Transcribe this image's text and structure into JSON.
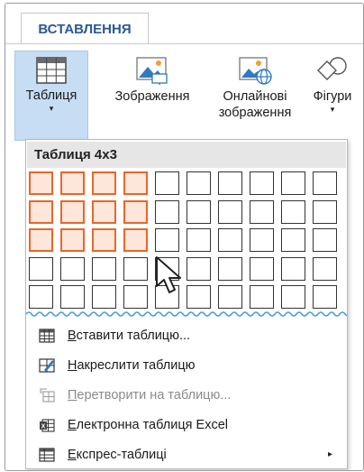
{
  "ribbon": {
    "tab_label": "ВСТАВЛЕННЯ",
    "buttons": [
      {
        "label": "Таблиця",
        "label2": "",
        "caret": "▾"
      },
      {
        "label": "Зображення",
        "label2": "",
        "caret": ""
      },
      {
        "label": "Онлайнові",
        "label2": "зображення",
        "caret": ""
      },
      {
        "label": "Фігури",
        "label2": "",
        "caret": "▾"
      }
    ]
  },
  "table_picker": {
    "header": "Таблиця 4x3",
    "columns": 10,
    "rows": 5,
    "selected_columns": 4,
    "selected_rows": 3
  },
  "menu": {
    "items": [
      {
        "accel": "В",
        "rest": "ставити таблицю...",
        "icon": "insert-table-icon",
        "enabled": true,
        "submenu": false
      },
      {
        "accel": "Н",
        "rest": "акреслити таблицю",
        "icon": "draw-table-icon",
        "enabled": true,
        "submenu": false
      },
      {
        "accel": "П",
        "rest": "еретворити на таблицю...",
        "icon": "convert-text-to-table-icon",
        "enabled": false,
        "submenu": false
      },
      {
        "accel": "Е",
        "rest": "лектронна таблиця Excel",
        "icon": "excel-spreadsheet-icon",
        "enabled": true,
        "submenu": false
      },
      {
        "accel": "Е",
        "rest": "кспрес-таблиці",
        "icon": "quick-tables-icon",
        "enabled": true,
        "submenu": true
      }
    ],
    "submenu_arrow": "▸"
  },
  "colors": {
    "accent": "#2b579a",
    "selected_cell_border": "#e8672a",
    "selected_cell_fill": "#fde6da",
    "active_button_bg": "#c7ddf3",
    "wavy_line": "#4a9fd6"
  }
}
